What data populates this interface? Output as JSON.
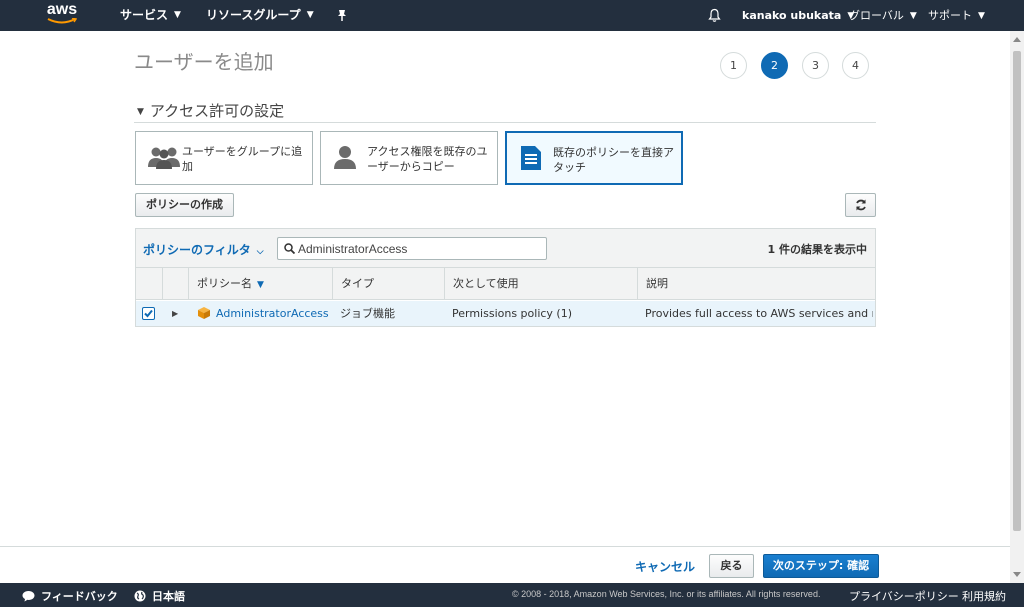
{
  "topnav": {
    "logo_text": "aws",
    "services": "サービス",
    "resource_groups": "リソースグループ",
    "user": "kanako ubukata",
    "region": "グローバル",
    "support": "サポート"
  },
  "page": {
    "title": "ユーザーを追加",
    "steps": [
      "1",
      "2",
      "3",
      "4"
    ],
    "active_step": 2
  },
  "section": {
    "title": "アクセス許可の設定",
    "options": [
      {
        "label": "ユーザーをグループに追加",
        "icon": "group-icon"
      },
      {
        "label": "アクセス権限を既存のユーザーからコピー",
        "icon": "user-icon"
      },
      {
        "label": "既存のポリシーを直接アタッチ",
        "icon": "document-icon",
        "selected": true
      }
    ]
  },
  "toolbar": {
    "create_policy": "ポリシーの作成"
  },
  "table": {
    "filter_label": "ポリシーのフィルタ",
    "search_value": "AdministratorAccess",
    "result_count": "1 件の結果を表示中",
    "columns": [
      "ポリシー名",
      "タイプ",
      "次として使用",
      "説明"
    ],
    "rows": [
      {
        "checked": true,
        "name": "AdministratorAccess",
        "type": "ジョブ機能",
        "used_as": "Permissions policy (1)",
        "description": "Provides full access to AWS services and re…"
      }
    ]
  },
  "actions": {
    "cancel": "キャンセル",
    "back": "戻る",
    "next": "次のステップ: 確認"
  },
  "footer": {
    "feedback": "フィードバック",
    "language": "日本語",
    "copyright": "© 2008 - 2018, Amazon Web Services, Inc. or its affiliates. All rights reserved.",
    "privacy": "プライバシーポリシー",
    "terms": "利用規約"
  },
  "colors": {
    "nav_bg": "#232f3e",
    "accent": "#0f6ab4",
    "aws_orange": "#ff9900"
  }
}
